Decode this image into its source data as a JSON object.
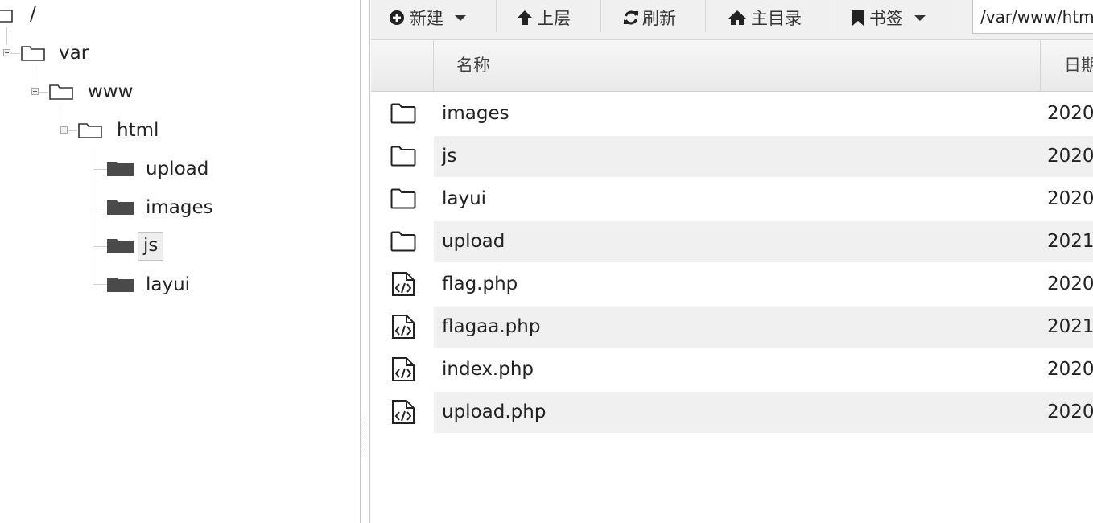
{
  "toolbar": {
    "new_label": "新建",
    "up_label": "上层",
    "refresh_label": "刷新",
    "home_label": "主目录",
    "bookmark_label": "书签",
    "path_value": "/var/www/html"
  },
  "tree": {
    "root": "/",
    "var": "var",
    "www": "www",
    "html": "html",
    "children": [
      "upload",
      "images",
      "js",
      "layui"
    ],
    "selected": "js"
  },
  "table": {
    "columns": {
      "name": "名称",
      "date": "日期"
    },
    "rows": [
      {
        "type": "folder",
        "name": "images",
        "date": "2020"
      },
      {
        "type": "folder",
        "name": "js",
        "date": "2020"
      },
      {
        "type": "folder",
        "name": "layui",
        "date": "2020"
      },
      {
        "type": "folder",
        "name": "upload",
        "date": "2021"
      },
      {
        "type": "code",
        "name": "flag.php",
        "date": "2020"
      },
      {
        "type": "code",
        "name": "flagaa.php",
        "date": "2021"
      },
      {
        "type": "code",
        "name": "index.php",
        "date": "2020"
      },
      {
        "type": "code",
        "name": "upload.php",
        "date": "2020"
      }
    ]
  },
  "icons": {
    "new": "plus-circle-icon",
    "up": "arrow-up-icon",
    "refresh": "refresh-icon",
    "home": "home-icon",
    "bookmark": "bookmark-icon",
    "folder_row": "folder-outline-icon",
    "code_row": "code-file-icon",
    "tree_folder": "folder-icon",
    "tree_subfolder": "folder-filled-icon"
  },
  "colors": {
    "toolbar_bg": "#f0f0f0",
    "row_alt_bg": "#f0f0f0",
    "selection_bg": "#eeeeee",
    "filled_folder": "#4a4a4a"
  }
}
